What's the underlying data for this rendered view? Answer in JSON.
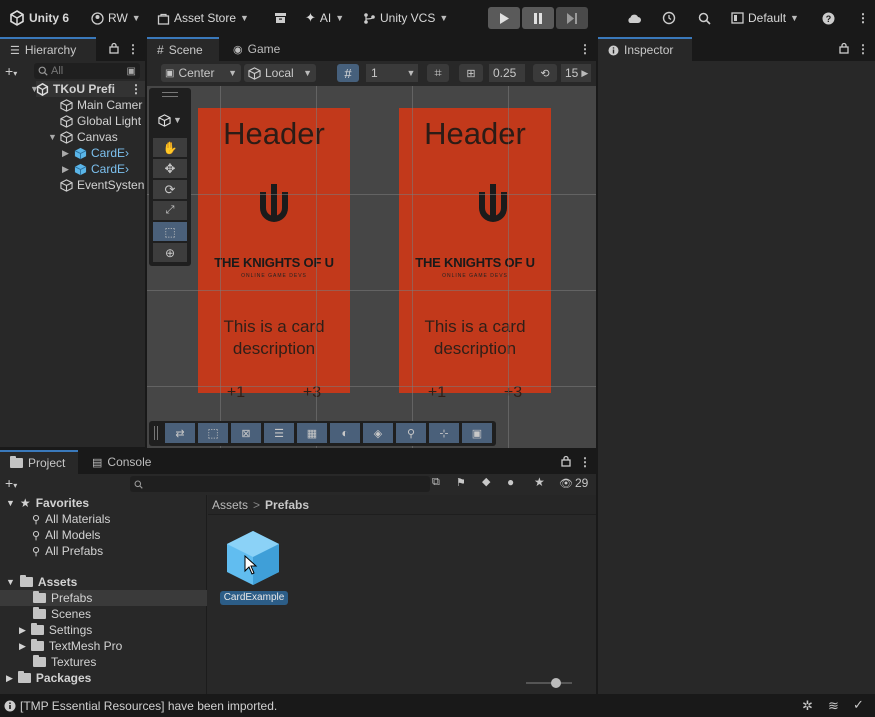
{
  "toolbar": {
    "app_title": "Unity 6",
    "account": "RW",
    "asset_store": "Asset Store",
    "ai": "AI",
    "vcs": "Unity VCS",
    "layout": "Default"
  },
  "hierarchy": {
    "tab_label": "Hierarchy",
    "search_placeholder": "All",
    "items": [
      {
        "label": "TKoU Prefab",
        "display": "TKoU Prefi"
      },
      {
        "label": "Main Camera",
        "display": "Main Camer"
      },
      {
        "label": "Global Light",
        "display": "Global Light"
      },
      {
        "label": "Canvas",
        "display": "Canvas"
      },
      {
        "label": "CardExample",
        "display": "CardE›"
      },
      {
        "label": "CardExample",
        "display": "CardE›"
      },
      {
        "label": "EventSystem",
        "display": "EventSysten"
      }
    ]
  },
  "scene": {
    "tab_scene": "Scene",
    "tab_game": "Game",
    "pivot": "Center",
    "space": "Local",
    "grid_size": "1",
    "snap_increment": "0.25",
    "rotation_snap": "15",
    "cards": [
      {
        "header": "Header",
        "logo_title": "THE KNIGHTS OF U",
        "logo_sub": "ONLINE GAME DEVS",
        "description": "This is a card description",
        "stat_left": "+1",
        "stat_right": "+3"
      },
      {
        "header": "Header",
        "logo_title": "THE KNIGHTS OF U",
        "logo_sub": "ONLINE GAME DEVS",
        "description": "This is a card description",
        "stat_left": "+1",
        "stat_right": "+3"
      }
    ]
  },
  "inspector": {
    "tab_label": "Inspector"
  },
  "project": {
    "tab_project": "Project",
    "tab_console": "Console",
    "hidden_count": "29",
    "breadcrumb_root": "Assets",
    "breadcrumb_sep": ">",
    "breadcrumb_current": "Prefabs",
    "favorites_label": "Favorites",
    "favorites": [
      "All Materials",
      "All Models",
      "All Prefabs"
    ],
    "assets_label": "Assets",
    "asset_folders": [
      "Prefabs",
      "Scenes",
      "Settings",
      "TextMesh Pro",
      "Textures"
    ],
    "packages_label": "Packages",
    "asset_item": "CardExample"
  },
  "status": {
    "message": "[TMP Essential Resources] have been imported."
  },
  "colors": {
    "accent": "#3a79bb",
    "card": "#c2391b",
    "selection": "#2c5d87"
  }
}
